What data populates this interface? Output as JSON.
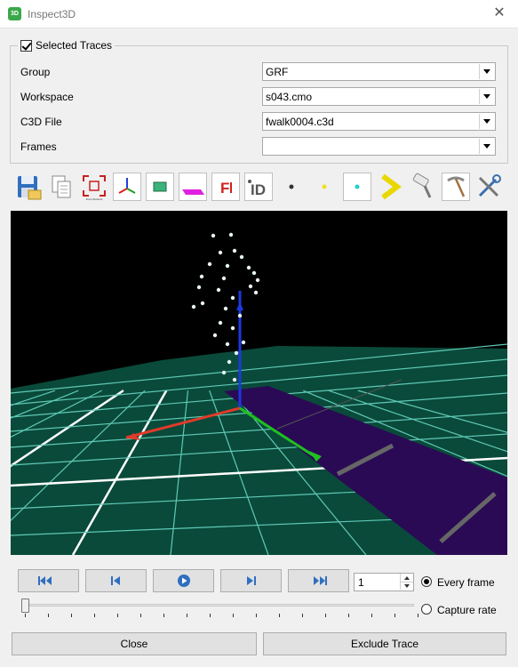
{
  "window": {
    "title": "Inspect3D",
    "icon_text": "3D"
  },
  "selected_traces": {
    "label": "Selected Traces",
    "checked": true,
    "rows": [
      {
        "label": "Group",
        "value": "GRF"
      },
      {
        "label": "Workspace",
        "value": "s043.cmo"
      },
      {
        "label": "C3D File",
        "value": "fwalk0004.c3d"
      },
      {
        "label": "Frames",
        "value": ""
      }
    ]
  },
  "toolbar": {
    "icons": [
      "save-icon",
      "copy-icon",
      "zoom-extents-icon",
      "axes-icon",
      "force-plate-icon",
      "plate-color-icon",
      "force-f-icon",
      "id-icon",
      "marker-black-icon",
      "marker-yellow-icon",
      "marker-cyan-icon",
      "chevron-yellow-icon",
      "paint-roller-icon",
      "pickaxe-icon",
      "tools-icon"
    ],
    "zoom_caption": "Zoom Extents"
  },
  "playback": {
    "buttons": [
      "first-frame-button",
      "prev-frame-button",
      "play-button",
      "next-frame-button",
      "last-frame-button"
    ],
    "frame_step": "1",
    "options": [
      {
        "label": "Every frame",
        "selected": true
      },
      {
        "label": "Capture rate",
        "selected": false
      }
    ],
    "slider_position": 0
  },
  "footer": {
    "close_label": "Close",
    "exclude_label": "Exclude Trace"
  },
  "colors": {
    "floor": "#0a4a3a",
    "grid": "#5fc9b6",
    "force_plate": "#2a0a55",
    "x_axis": "#e03a2a",
    "y_axis": "#20c020",
    "z_axis": "#1a3adf"
  }
}
